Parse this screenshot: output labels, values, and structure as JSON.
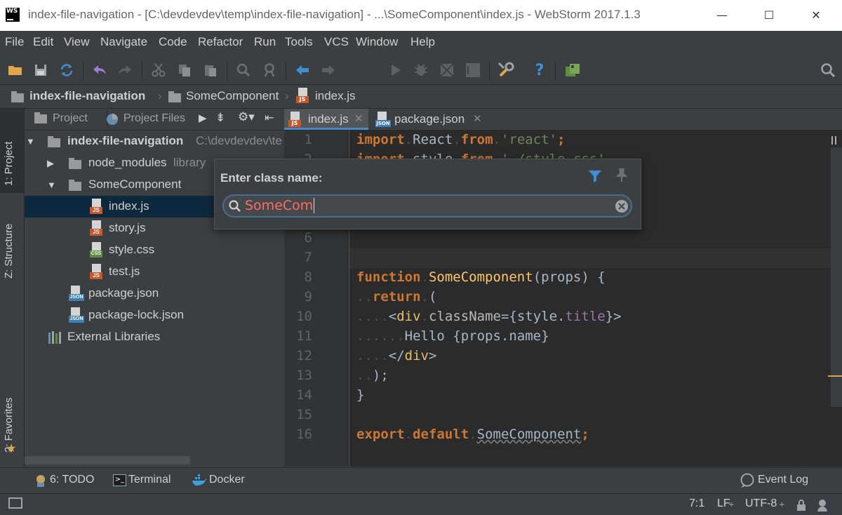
{
  "window": {
    "title": "index-file-navigation - [C:\\devdevdev\\temp\\index-file-navigation] - ...\\SomeComponent\\index.js - WebStorm 2017.1.3",
    "logo": "WS"
  },
  "menu": [
    "File",
    "Edit",
    "View",
    "Navigate",
    "Code",
    "Refactor",
    "Run",
    "Tools",
    "VCS",
    "Window",
    "Help"
  ],
  "breadcrumb": {
    "project": "index-file-navigation",
    "folder": "SomeComponent",
    "file": "index.js"
  },
  "left_stripe": {
    "project": "1: Project",
    "structure": "Z: Structure",
    "favorites": "2: Favorites"
  },
  "project_panel": {
    "tab_project": "Project",
    "tab_files": "Project Files",
    "root": "index-file-navigation",
    "root_path": "C:\\devdevdev\\te",
    "node_modules": "node_modules",
    "node_modules_hint": "library",
    "some_component": "SomeComponent",
    "files": [
      "index.js",
      "story.js",
      "style.css",
      "test.js"
    ],
    "file_badges": [
      "JS",
      "JS",
      "CSS",
      "JS"
    ],
    "package_json": "package.json",
    "package_lock": "package-lock.json",
    "json_badge": "JSON",
    "external": "External Libraries"
  },
  "editor_tabs": [
    {
      "label": "index.js",
      "badge": "JS"
    },
    {
      "label": "package.json",
      "badge": "JSON"
    }
  ],
  "code": {
    "line_numbers": [
      "1",
      "2",
      "6",
      "7",
      "8",
      "9",
      "10",
      "11",
      "12",
      "13",
      "14",
      "15",
      "16"
    ],
    "line1": {
      "k1": "import",
      "id": "React",
      "k2": "from",
      "s": "'react'",
      "end": ";"
    },
    "line2": {
      "k1": "import",
      "id": "style",
      "k2": "from",
      "s": "'./style.css'"
    },
    "line8": {
      "k": "function",
      "name": "SomeComponent",
      "rest": "(props) {"
    },
    "line9": {
      "k": "return",
      "rest": "("
    },
    "line10": {
      "open": "<",
      "tag": "div",
      "attr": "className",
      "eq": "={",
      "obj": "style.",
      "prop": "title",
      "close": "}>"
    },
    "line11": "Hello {props.name}",
    "line12": {
      "open": "</",
      "tag": "div",
      "close": ">"
    },
    "line13": ");",
    "line14": "}",
    "line16": {
      "k1": "export",
      "k2": "default",
      "id": "SomeComponent",
      "end": ";"
    }
  },
  "popup": {
    "title": "Enter class name:",
    "input_value": "SomeCom"
  },
  "bottom_tabs": {
    "todo": "6: TODO",
    "terminal": "Terminal",
    "docker": "Docker",
    "event_log": "Event Log"
  },
  "status": {
    "position": "7:1",
    "line_sep": "LF",
    "encoding": "UTF-8"
  },
  "colors": {
    "accent": "#466d94",
    "selection": "#0d293e",
    "keyword": "#cc7832",
    "string": "#6a8759",
    "function": "#ffc66d",
    "search_text": "#ff6b68"
  }
}
